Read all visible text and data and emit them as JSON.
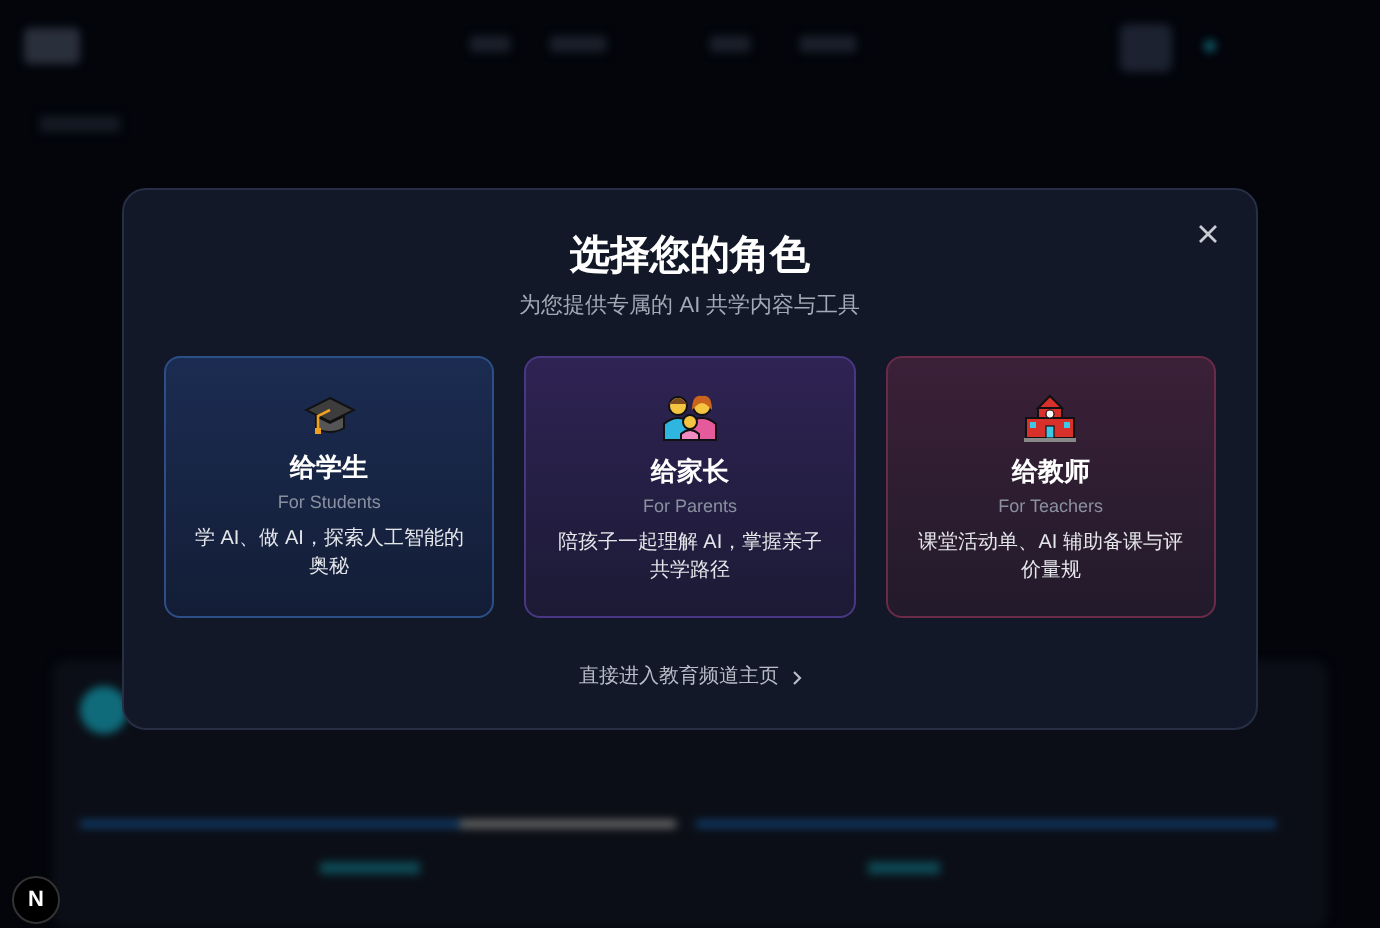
{
  "dialog": {
    "title": "选择您的角色",
    "subtitle": "为您提供专属的 AI 共学内容与工具",
    "roles": [
      {
        "kind": "student",
        "title": "给学生",
        "subtitle": "For Students",
        "description": "学 AI、做 AI，探索人工智能的奥秘"
      },
      {
        "kind": "parent",
        "title": "给家长",
        "subtitle": "For Parents",
        "description": "陪孩子一起理解 AI，掌握亲子共学路径"
      },
      {
        "kind": "teacher",
        "title": "给教师",
        "subtitle": "For Teachers",
        "description": "课堂活动单、AI 辅助备课与评价量规"
      }
    ],
    "link": "直接进入教育频道主页"
  },
  "dev_badge": "N"
}
